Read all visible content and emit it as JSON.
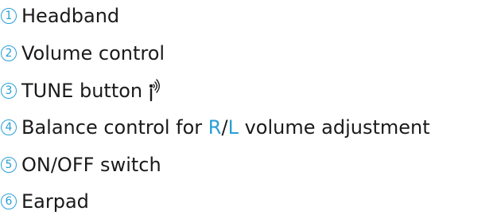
{
  "accent_color": "#2a9fd6",
  "parts": [
    {
      "number": "1",
      "label": "Headband"
    },
    {
      "number": "2",
      "label": "Volume control"
    },
    {
      "number": "3",
      "label": "TUNE button",
      "icon": "tune-wave-icon"
    },
    {
      "number": "4",
      "label_before": "Balance control for ",
      "label_r": "R",
      "label_slash": "/",
      "label_l": "L",
      "label_after": " volume adjustment"
    },
    {
      "number": "5",
      "label": "ON/OFF switch"
    },
    {
      "number": "6",
      "label": "Earpad"
    }
  ]
}
